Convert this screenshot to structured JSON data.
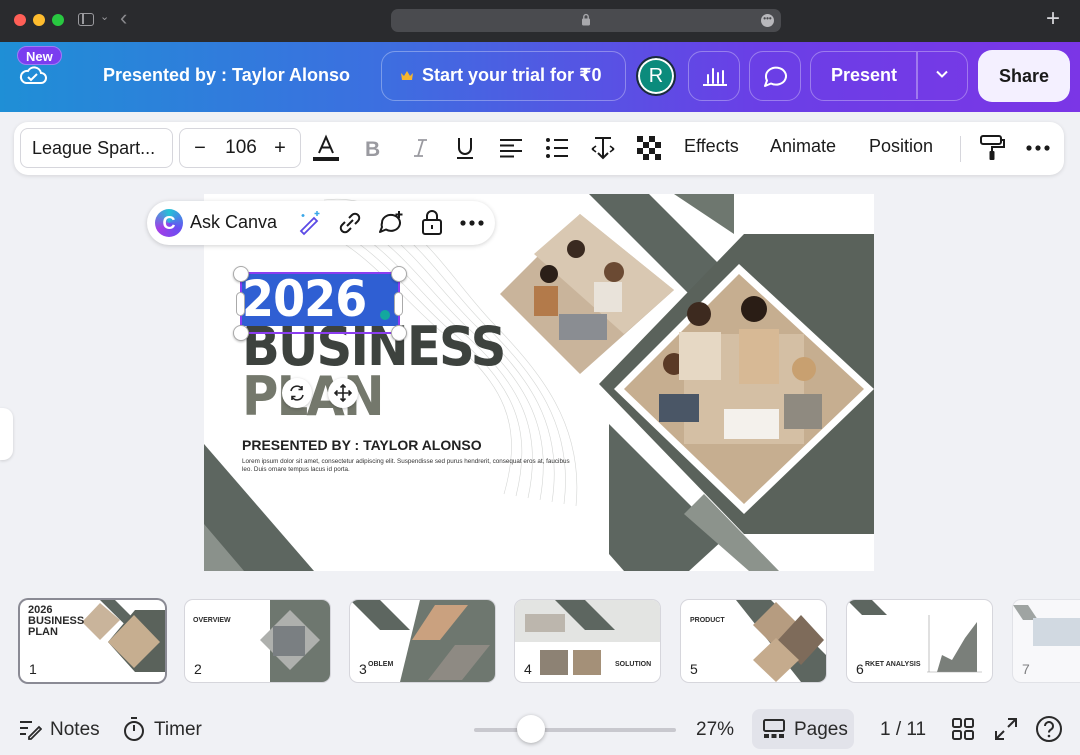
{
  "browser": {
    "traffic_lights": [
      "#ff5f57",
      "#febc2e",
      "#28c840"
    ]
  },
  "header": {
    "new_badge": "New",
    "presented_by": "Presented by : Taylor Alonso",
    "trial_label": "Start your trial for ₹0",
    "avatar_initial": "R",
    "present_label": "Present",
    "share_label": "Share",
    "gradient": [
      "#1f8fd6",
      "#7b36e6"
    ]
  },
  "toolbar": {
    "font_name": "League Spart...",
    "font_size": "106",
    "decrease": "−",
    "increase": "+",
    "effects": "Effects",
    "animate": "Animate",
    "position": "Position"
  },
  "ask_canva": {
    "label": "Ask Canva"
  },
  "slide": {
    "year": "2026",
    "title_line1": "BUSINESS",
    "title_line2": "PLAN",
    "presented_by": "PRESENTED BY : TAYLOR ALONSO",
    "lorem": "Lorem ipsum dolor sit amet, consectetur adipiscing elit. Suspendisse sed purus hendrerit, consequat eros at, faucibus leo. Duis ornare tempus lacus id porta.",
    "accent": "#5d6660"
  },
  "thumbnails": [
    {
      "num": "1",
      "label": "2026 BUSINESS PLAN",
      "active": true
    },
    {
      "num": "2",
      "label": "OVERVIEW",
      "active": false
    },
    {
      "num": "3",
      "label": "OBLEM",
      "active": false
    },
    {
      "num": "4",
      "label": "SOLUTION",
      "active": false
    },
    {
      "num": "5",
      "label": "PRODUCT",
      "active": false
    },
    {
      "num": "6",
      "label": "RKET ANALYSIS",
      "active": false
    },
    {
      "num": "7",
      "label": "",
      "active": false
    }
  ],
  "bottom": {
    "notes": "Notes",
    "timer": "Timer",
    "zoom": "27%",
    "zoom_fraction": 0.27,
    "pages": "Pages",
    "page_indicator": "1 / 11"
  }
}
